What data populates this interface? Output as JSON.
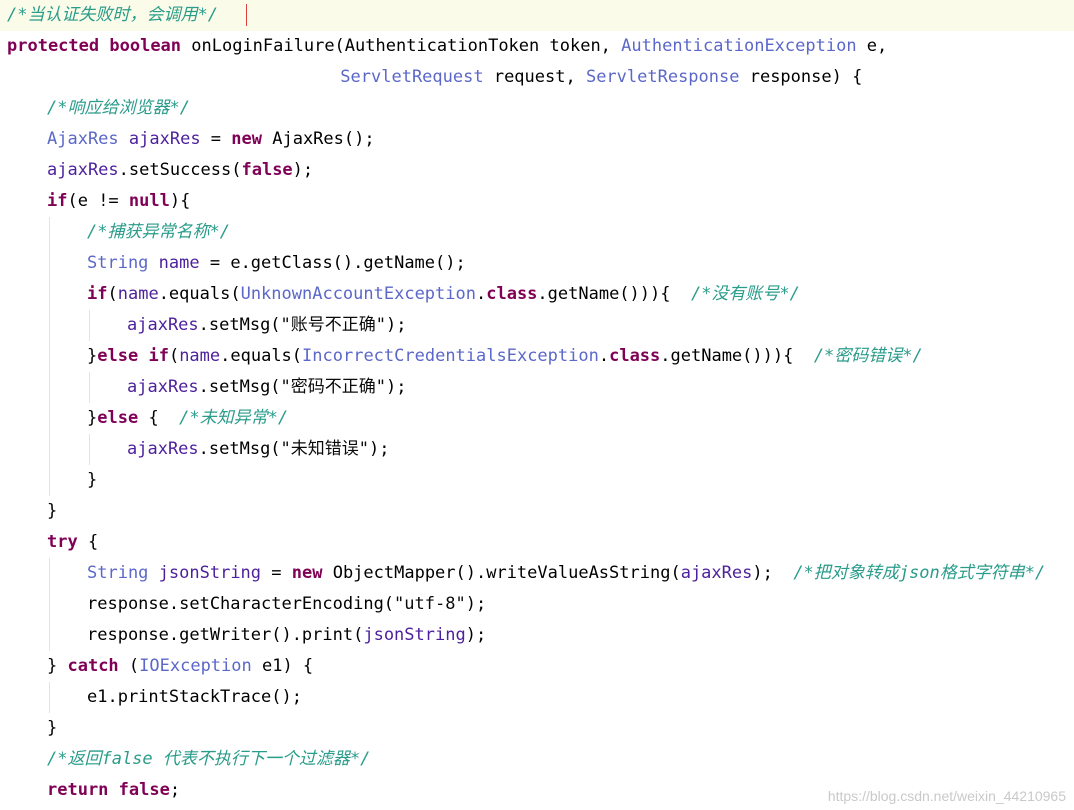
{
  "editor": {
    "lines": [
      {
        "indent": 0,
        "current": true,
        "tokens": [
          {
            "t": "/*当认证失败时，会调用*/",
            "c": "cmt"
          }
        ]
      },
      {
        "indent": 0,
        "tokens": [
          {
            "t": "protected",
            "c": "kw"
          },
          {
            "t": " ",
            "c": "plain"
          },
          {
            "t": "boolean",
            "c": "kw"
          },
          {
            "t": " onLoginFailure(",
            "c": "plain"
          },
          {
            "t": "AuthenticationToken",
            "c": "plain"
          },
          {
            "t": " token, ",
            "c": "plain"
          },
          {
            "t": "AuthenticationException",
            "c": "type"
          },
          {
            "t": " e,",
            "c": "plain"
          }
        ]
      },
      {
        "indent": 0,
        "pad": 33,
        "tokens": [
          {
            "t": "ServletRequest",
            "c": "type"
          },
          {
            "t": " request, ",
            "c": "plain"
          },
          {
            "t": "ServletResponse",
            "c": "type"
          },
          {
            "t": " response) {",
            "c": "plain"
          }
        ]
      },
      {
        "indent": 1,
        "tokens": [
          {
            "t": "/*响应给浏览器*/",
            "c": "cmt"
          }
        ]
      },
      {
        "indent": 1,
        "tokens": [
          {
            "t": "AjaxRes",
            "c": "type"
          },
          {
            "t": " ",
            "c": "plain"
          },
          {
            "t": "ajaxRes",
            "c": "var"
          },
          {
            "t": " = ",
            "c": "plain"
          },
          {
            "t": "new",
            "c": "kw"
          },
          {
            "t": " AjaxRes();",
            "c": "plain"
          }
        ]
      },
      {
        "indent": 1,
        "tokens": [
          {
            "t": "ajaxRes",
            "c": "var"
          },
          {
            "t": ".setSuccess(",
            "c": "plain"
          },
          {
            "t": "false",
            "c": "kw"
          },
          {
            "t": ");",
            "c": "plain"
          }
        ]
      },
      {
        "indent": 1,
        "tokens": [
          {
            "t": "if",
            "c": "kw"
          },
          {
            "t": "(e != ",
            "c": "plain"
          },
          {
            "t": "null",
            "c": "kw"
          },
          {
            "t": "){",
            "c": "plain"
          }
        ]
      },
      {
        "indent": 2,
        "tokens": [
          {
            "t": "/*捕获异常名称*/",
            "c": "cmt"
          }
        ]
      },
      {
        "indent": 2,
        "tokens": [
          {
            "t": "String",
            "c": "type"
          },
          {
            "t": " ",
            "c": "plain"
          },
          {
            "t": "name",
            "c": "var"
          },
          {
            "t": " = e.getClass().getName();",
            "c": "plain"
          }
        ]
      },
      {
        "indent": 2,
        "tokens": [
          {
            "t": "if",
            "c": "kw"
          },
          {
            "t": "(",
            "c": "plain"
          },
          {
            "t": "name",
            "c": "var"
          },
          {
            "t": ".equals(",
            "c": "plain"
          },
          {
            "t": "UnknownAccountException",
            "c": "type"
          },
          {
            "t": ".",
            "c": "plain"
          },
          {
            "t": "class",
            "c": "kw"
          },
          {
            "t": ".getName())){  ",
            "c": "plain"
          },
          {
            "t": "/*没有账号*/",
            "c": "cmt"
          }
        ]
      },
      {
        "indent": 3,
        "tokens": [
          {
            "t": "ajaxRes",
            "c": "var"
          },
          {
            "t": ".setMsg(",
            "c": "plain"
          },
          {
            "t": "\"账号不正确\"",
            "c": "str"
          },
          {
            "t": ");",
            "c": "plain"
          }
        ]
      },
      {
        "indent": 2,
        "tokens": [
          {
            "t": "}",
            "c": "plain"
          },
          {
            "t": "else",
            "c": "kw"
          },
          {
            "t": " ",
            "c": "plain"
          },
          {
            "t": "if",
            "c": "kw"
          },
          {
            "t": "(",
            "c": "plain"
          },
          {
            "t": "name",
            "c": "var"
          },
          {
            "t": ".equals(",
            "c": "plain"
          },
          {
            "t": "IncorrectCredentialsException",
            "c": "type"
          },
          {
            "t": ".",
            "c": "plain"
          },
          {
            "t": "class",
            "c": "kw"
          },
          {
            "t": ".getName())){  ",
            "c": "plain"
          },
          {
            "t": "/*密码错误*/",
            "c": "cmt"
          }
        ]
      },
      {
        "indent": 3,
        "tokens": [
          {
            "t": "ajaxRes",
            "c": "var"
          },
          {
            "t": ".setMsg(",
            "c": "plain"
          },
          {
            "t": "\"密码不正确\"",
            "c": "str"
          },
          {
            "t": ");",
            "c": "plain"
          }
        ]
      },
      {
        "indent": 2,
        "tokens": [
          {
            "t": "}",
            "c": "plain"
          },
          {
            "t": "else",
            "c": "kw"
          },
          {
            "t": " {  ",
            "c": "plain"
          },
          {
            "t": "/*未知异常*/",
            "c": "cmt"
          }
        ]
      },
      {
        "indent": 3,
        "tokens": [
          {
            "t": "ajaxRes",
            "c": "var"
          },
          {
            "t": ".setMsg(",
            "c": "plain"
          },
          {
            "t": "\"未知错误\"",
            "c": "str"
          },
          {
            "t": ");",
            "c": "plain"
          }
        ]
      },
      {
        "indent": 2,
        "tokens": [
          {
            "t": "}",
            "c": "plain"
          }
        ]
      },
      {
        "indent": 1,
        "tokens": [
          {
            "t": "}",
            "c": "plain"
          }
        ]
      },
      {
        "indent": 1,
        "tokens": [
          {
            "t": "try",
            "c": "kw"
          },
          {
            "t": " {",
            "c": "plain"
          }
        ]
      },
      {
        "indent": 2,
        "tokens": [
          {
            "t": "String",
            "c": "type"
          },
          {
            "t": " ",
            "c": "plain"
          },
          {
            "t": "jsonString",
            "c": "var"
          },
          {
            "t": " = ",
            "c": "plain"
          },
          {
            "t": "new",
            "c": "kw"
          },
          {
            "t": " ObjectMapper().writeValueAsString(",
            "c": "plain"
          },
          {
            "t": "ajaxRes",
            "c": "var"
          },
          {
            "t": ");  ",
            "c": "plain"
          },
          {
            "t": "/*把对象转成json格式字符串*/",
            "c": "cmt"
          }
        ]
      },
      {
        "indent": 2,
        "tokens": [
          {
            "t": "response.setCharacterEncoding(",
            "c": "plain"
          },
          {
            "t": "\"utf-8\"",
            "c": "str"
          },
          {
            "t": ");",
            "c": "plain"
          }
        ]
      },
      {
        "indent": 2,
        "tokens": [
          {
            "t": "response.getWriter().print(",
            "c": "plain"
          },
          {
            "t": "jsonString",
            "c": "var"
          },
          {
            "t": ");",
            "c": "plain"
          }
        ]
      },
      {
        "indent": 1,
        "tokens": [
          {
            "t": "} ",
            "c": "plain"
          },
          {
            "t": "catch",
            "c": "kw"
          },
          {
            "t": " (",
            "c": "plain"
          },
          {
            "t": "IOException",
            "c": "type"
          },
          {
            "t": " e1) {",
            "c": "plain"
          }
        ]
      },
      {
        "indent": 2,
        "tokens": [
          {
            "t": "e1.printStackTrace();",
            "c": "plain"
          }
        ]
      },
      {
        "indent": 1,
        "tokens": [
          {
            "t": "}",
            "c": "plain"
          }
        ]
      },
      {
        "indent": 1,
        "tokens": [
          {
            "t": "/*返回false 代表不执行下一个过滤器*/",
            "c": "cmt"
          }
        ]
      },
      {
        "indent": 1,
        "tokens": [
          {
            "t": "return",
            "c": "kw"
          },
          {
            "t": " ",
            "c": "plain"
          },
          {
            "t": "false",
            "c": "kw"
          },
          {
            "t": ";",
            "c": "plain"
          }
        ]
      }
    ]
  },
  "watermark": "https://blog.csdn.net/weixin_44210965"
}
